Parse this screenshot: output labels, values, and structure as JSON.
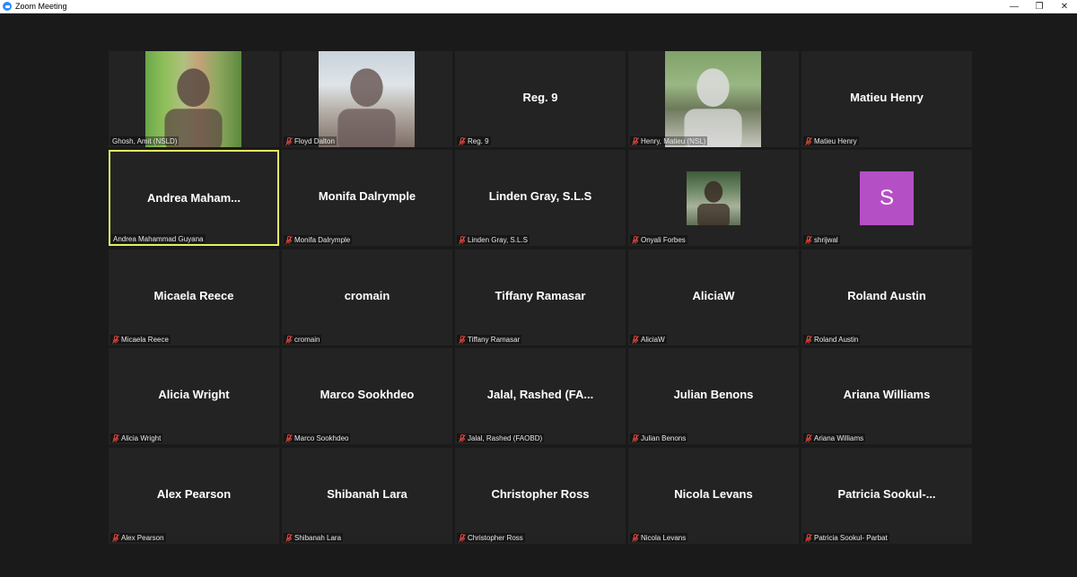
{
  "window": {
    "title": "Zoom Meeting",
    "minimize": "—",
    "restore": "❐",
    "close": "✕"
  },
  "colors": {
    "tile_background": "#232323",
    "active_speaker_border": "#e2f062",
    "mute_icon": "#d9453a",
    "avatar_s": "#b54fc6"
  },
  "participants": [
    {
      "label": "Ghosh, Amit (NSLD)",
      "big": "",
      "muted": false,
      "video": true
    },
    {
      "label": "Floyd Dalton",
      "big": "",
      "muted": true,
      "video": true
    },
    {
      "label": "Reg. 9",
      "big": "Reg. 9",
      "muted": true,
      "video": false
    },
    {
      "label": "Henry, Matieu (NSL)",
      "big": "",
      "muted": true,
      "video": true
    },
    {
      "label": "Matieu Henry",
      "big": "Matieu Henry",
      "muted": true,
      "video": false
    },
    {
      "label": "Andrea Mahammad Guyana",
      "big": "Andrea  Maham...",
      "muted": false,
      "video": false,
      "active": true
    },
    {
      "label": "Monifa Dalrymple",
      "big": "Monifa Dalrymple",
      "muted": true,
      "video": false
    },
    {
      "label": "Linden Gray, S.L.S",
      "big": "Linden Gray, S.L.S",
      "muted": true,
      "video": false
    },
    {
      "label": "Onyali Forbes",
      "big": "",
      "muted": true,
      "video": true
    },
    {
      "label": "shrijwal",
      "big": "",
      "muted": true,
      "video": false,
      "avatar": "S"
    },
    {
      "label": "Micaela Reece",
      "big": "Micaela Reece",
      "muted": true,
      "video": false
    },
    {
      "label": "cromain",
      "big": "cromain",
      "muted": true,
      "video": false
    },
    {
      "label": "Tiffany Ramasar",
      "big": "Tiffany Ramasar",
      "muted": true,
      "video": false
    },
    {
      "label": "AliciaW",
      "big": "AliciaW",
      "muted": true,
      "video": false
    },
    {
      "label": "Roland Austin",
      "big": "Roland Austin",
      "muted": true,
      "video": false
    },
    {
      "label": "Alicia Wright",
      "big": "Alicia Wright",
      "muted": true,
      "video": false
    },
    {
      "label": "Marco Sookhdeo",
      "big": "Marco Sookhdeo",
      "muted": true,
      "video": false
    },
    {
      "label": "Jalal, Rashed (FAOBD)",
      "big": "Jalal,  Rashed  (FA...",
      "muted": true,
      "video": false
    },
    {
      "label": "Julian Benons",
      "big": "Julian Benons",
      "muted": true,
      "video": false
    },
    {
      "label": "Ariana Williams",
      "big": "Ariana Williams",
      "muted": true,
      "video": false
    },
    {
      "label": "Alex Pearson",
      "big": "Alex Pearson",
      "muted": true,
      "video": false
    },
    {
      "label": "Shibanah Lara",
      "big": "Shibanah Lara",
      "muted": true,
      "video": false
    },
    {
      "label": "Christopher Ross",
      "big": "Christopher Ross",
      "muted": true,
      "video": false
    },
    {
      "label": "Nicola Levans",
      "big": "Nicola Levans",
      "muted": true,
      "video": false
    },
    {
      "label": "Patricia Sookul- Parbat",
      "big": "Patricia  Sookul-...",
      "muted": true,
      "video": false
    }
  ]
}
